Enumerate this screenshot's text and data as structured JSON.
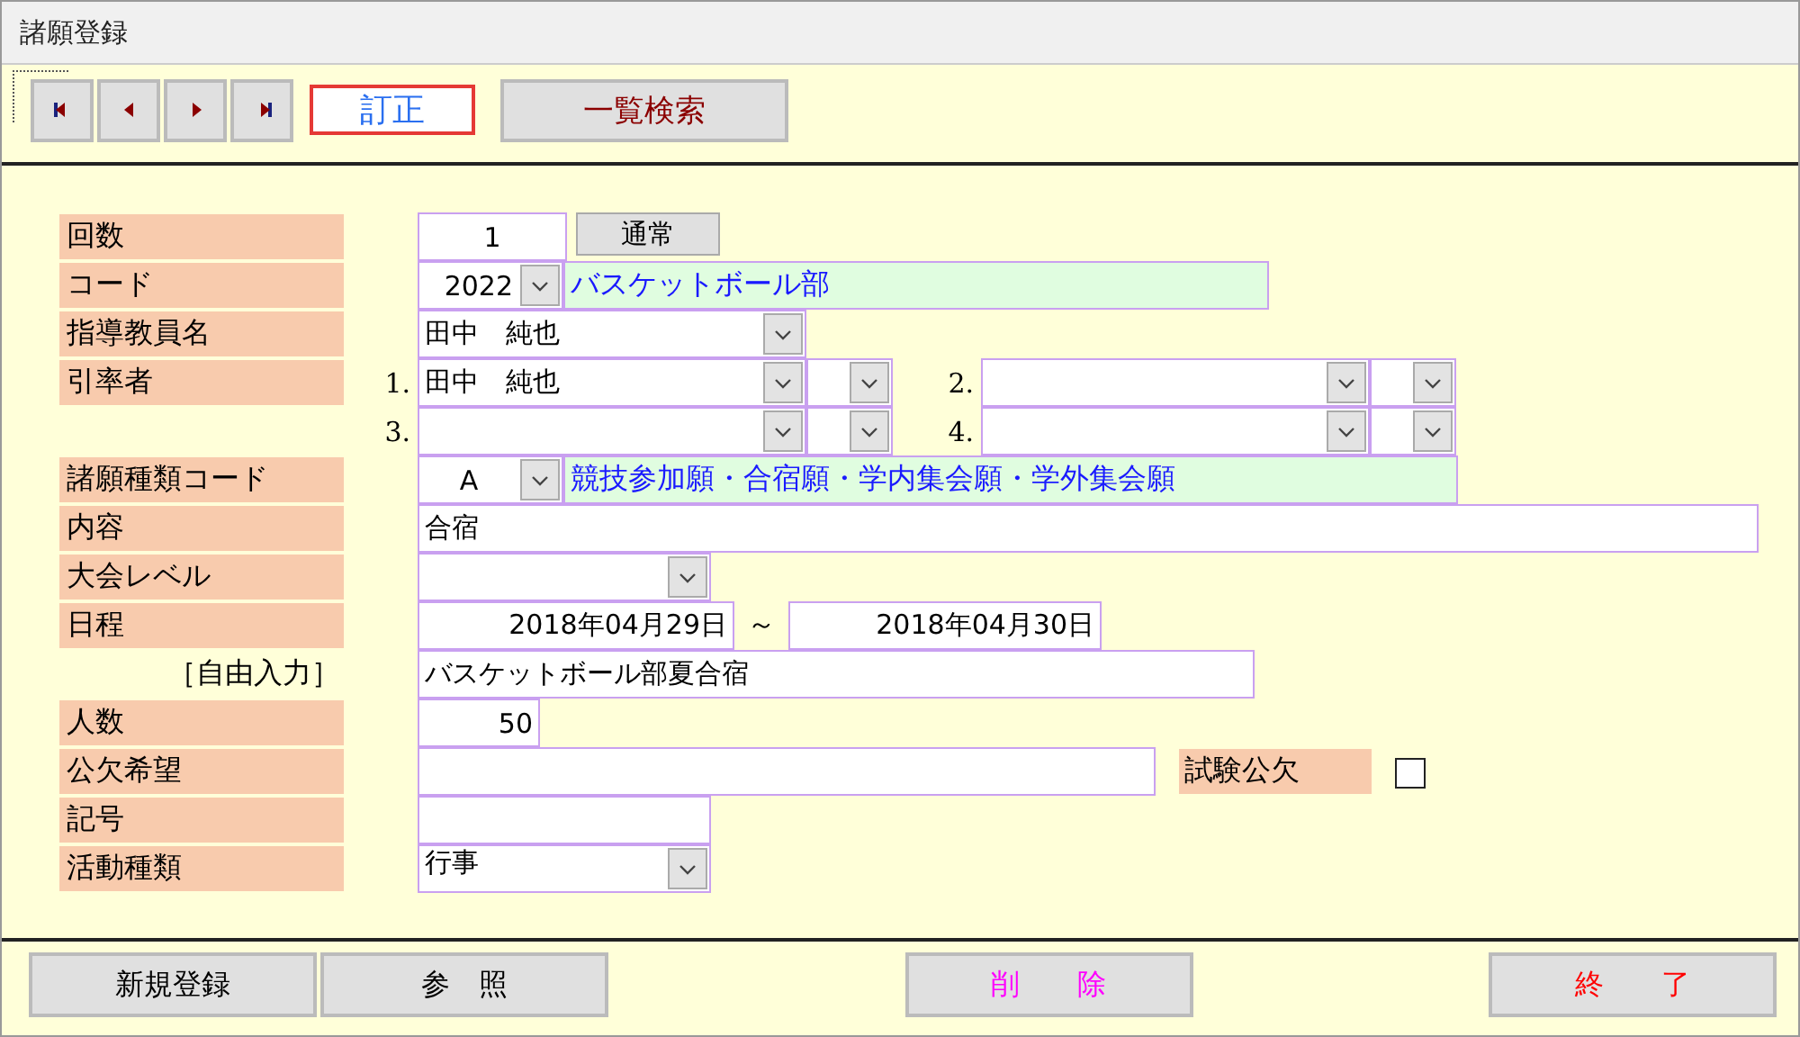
{
  "window": {
    "title": "諸願登録"
  },
  "toolbar": {
    "nav_buttons": [
      {
        "kind": "first"
      },
      {
        "kind": "previous"
      },
      {
        "kind": "next"
      },
      {
        "kind": "last"
      }
    ],
    "mode": "訂正",
    "search_button": "一覧検索"
  },
  "form": {
    "count": {
      "label": "回数",
      "value": "1",
      "button": "通常"
    },
    "code": {
      "label": "コード",
      "value": "2022",
      "name": "バスケットボール部"
    },
    "teacher": {
      "label": "指導教員名",
      "value": "田中　純也"
    },
    "leaders": {
      "label": "引率者",
      "items": [
        {
          "number": "1.",
          "value": "田中　純也"
        },
        {
          "number": "2."
        },
        {
          "number": "3."
        },
        {
          "number": "4."
        }
      ]
    },
    "request_type": {
      "label": "諸願種類コード",
      "value": "A",
      "name": "競技参加願・合宿願・学内集会願・学外集会願"
    },
    "content": {
      "label": "内容",
      "value": "合宿"
    },
    "level": {
      "label": "大会レベル"
    },
    "schedule": {
      "label": "日程",
      "start": "2018年04月29日",
      "separator": "～",
      "end": "2018年04月30日"
    },
    "free_input": {
      "label": "［自由入力］",
      "value": "バスケットボール部夏合宿"
    },
    "headcount": {
      "label": "人数",
      "value": "50"
    },
    "absence": {
      "label": "公欠希望",
      "exam_label": "試験公欠",
      "exam_checked": false
    },
    "symbol": {
      "label": "記号"
    },
    "activity": {
      "label": "活動種類",
      "value": "行事"
    }
  },
  "footer": [
    {
      "label": "新規登録",
      "kind": "normal"
    },
    {
      "label": "参　照",
      "kind": "normal"
    },
    {
      "label": "削　　除",
      "kind": "delete"
    },
    {
      "label": "終　　了",
      "kind": "exit"
    }
  ]
}
